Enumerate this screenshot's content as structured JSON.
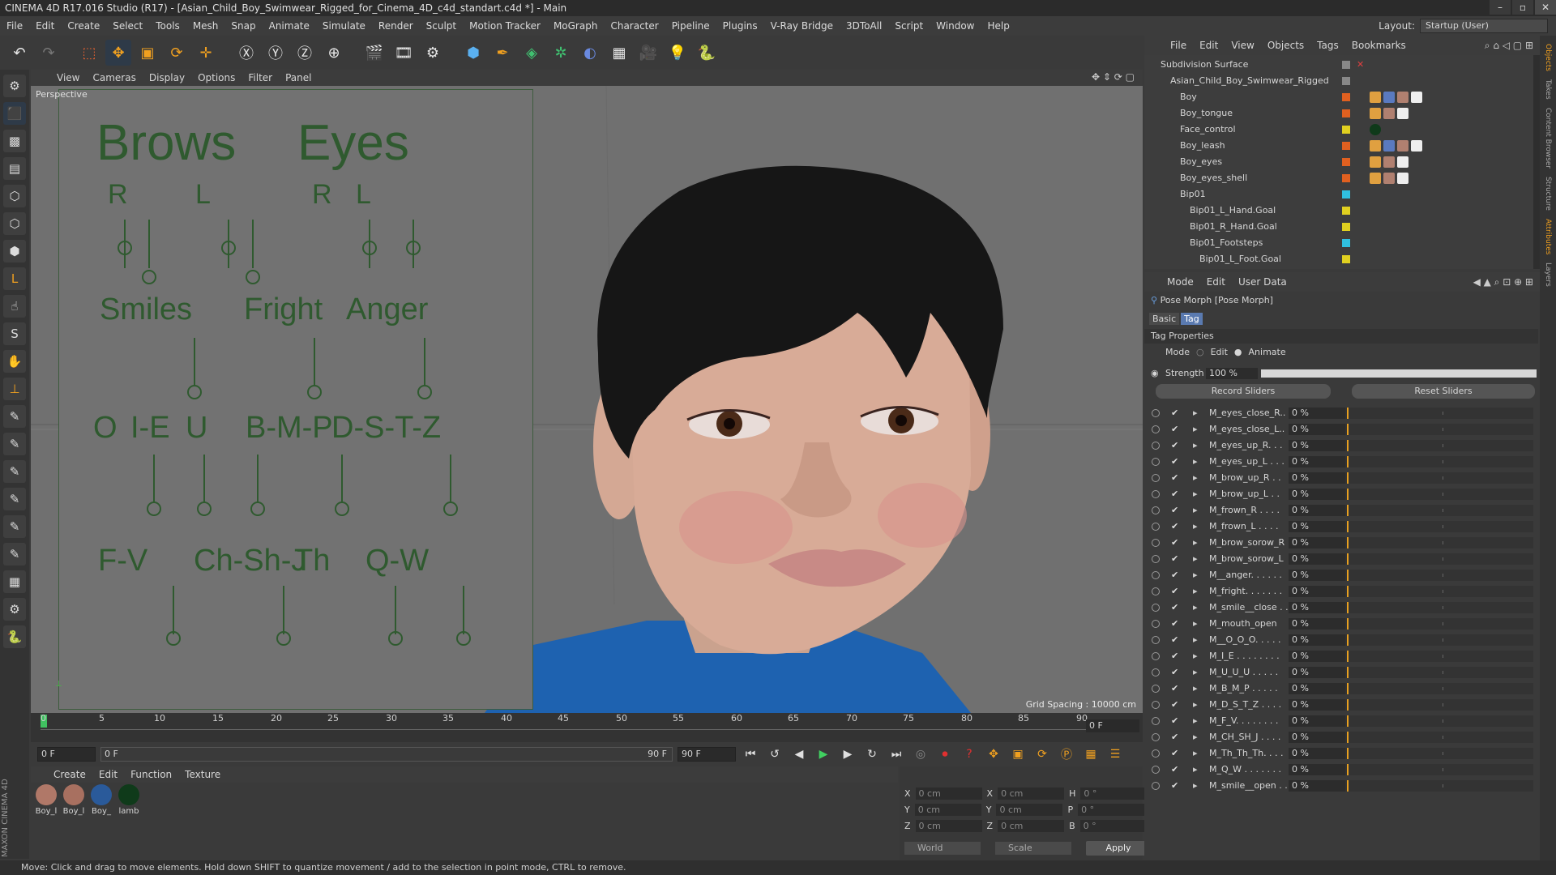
{
  "window": {
    "title": "CINEMA 4D R17.016 Studio (R17) - [Asian_Child_Boy_Swimwear_Rigged_for_Cinema_4D_c4d_standart.c4d *] - Main"
  },
  "menubar": {
    "items": [
      "File",
      "Edit",
      "Create",
      "Select",
      "Tools",
      "Mesh",
      "Snap",
      "Animate",
      "Simulate",
      "Render",
      "Sculpt",
      "Motion Tracker",
      "MoGraph",
      "Character",
      "Pipeline",
      "Plugins",
      "V-Ray Bridge",
      "3DToAll",
      "Script",
      "Window",
      "Help"
    ],
    "layout_label": "Layout:",
    "layout_value": "Startup (User)"
  },
  "viewport": {
    "menu": [
      "View",
      "Cameras",
      "Display",
      "Options",
      "Filter",
      "Panel"
    ],
    "camera": "Perspective",
    "grid_spacing": "Grid Spacing : 10000 cm"
  },
  "face_board": {
    "headers": [
      "Brows",
      "Eyes"
    ],
    "brow_lr": [
      "R",
      "L"
    ],
    "eyes_lr": [
      "R",
      "L"
    ],
    "expressions": [
      "Smiles",
      "Fright",
      "Anger"
    ],
    "phonemes_row1": [
      "O",
      "I-E",
      "U",
      "B-M-P",
      "D-S-T-Z"
    ],
    "phonemes_row2": [
      "F-V",
      "Ch-Sh-J",
      "Th",
      "Q-W"
    ]
  },
  "timeline": {
    "ticks": [
      "0",
      "5",
      "10",
      "15",
      "20",
      "25",
      "30",
      "35",
      "40",
      "45",
      "50",
      "55",
      "60",
      "65",
      "70",
      "75",
      "80",
      "85",
      "90"
    ],
    "current_frame": "0 F"
  },
  "playback": {
    "start": "0 F",
    "range_start": "0 F",
    "range_end": "90 F",
    "end": "90 F"
  },
  "material_manager": {
    "menu": [
      "Create",
      "Edit",
      "Function",
      "Texture"
    ],
    "materials": [
      {
        "name": "Boy_l",
        "color": "#b07868"
      },
      {
        "name": "Boy_l",
        "color": "#a87060"
      },
      {
        "name": "Boy_",
        "color": "#2a5a9a"
      },
      {
        "name": "lamb",
        "color": "#0f3a1a"
      }
    ]
  },
  "coordinates": {
    "rows": [
      {
        "a_label": "X",
        "a_val": "0 cm",
        "b_label": "X",
        "b_val": "0 cm",
        "c_label": "H",
        "c_val": "0 °"
      },
      {
        "a_label": "Y",
        "a_val": "0 cm",
        "b_label": "Y",
        "b_val": "0 cm",
        "c_label": "P",
        "c_val": "0 °"
      },
      {
        "a_label": "Z",
        "a_val": "0 cm",
        "b_label": "Z",
        "b_val": "0 cm",
        "c_label": "B",
        "c_val": "0 °"
      }
    ],
    "space": "World",
    "mode": "Scale",
    "apply": "Apply"
  },
  "status": "Move: Click and drag to move elements. Hold down SHIFT to quantize movement / add to the selection in point mode, CTRL to remove.",
  "object_manager": {
    "menu": [
      "File",
      "Edit",
      "View",
      "Objects",
      "Tags",
      "Bookmarks"
    ],
    "objects": [
      {
        "name": "Subdivision Surface",
        "indent": 0,
        "color": "#888888"
      },
      {
        "name": "Asian_Child_Boy_Swimwear_Rigged",
        "indent": 1,
        "color": "#888888"
      },
      {
        "name": "Boy",
        "indent": 2,
        "color": "#e06020"
      },
      {
        "name": "Boy_tongue",
        "indent": 2,
        "color": "#e06020"
      },
      {
        "name": "Face_control",
        "indent": 2,
        "color": "#e0d020"
      },
      {
        "name": "Boy_leash",
        "indent": 2,
        "color": "#e06020"
      },
      {
        "name": "Boy_eyes",
        "indent": 2,
        "color": "#e06020"
      },
      {
        "name": "Boy_eyes_shell",
        "indent": 2,
        "color": "#e06020"
      },
      {
        "name": "Bip01",
        "indent": 2,
        "color": "#30c0e0"
      },
      {
        "name": "Bip01_L_Hand.Goal",
        "indent": 3,
        "color": "#e0d020"
      },
      {
        "name": "Bip01_R_Hand.Goal",
        "indent": 3,
        "color": "#e0d020"
      },
      {
        "name": "Bip01_Footsteps",
        "indent": 3,
        "color": "#30c0e0"
      },
      {
        "name": "Bip01_L_Foot.Goal",
        "indent": 4,
        "color": "#e0d020"
      }
    ]
  },
  "attribute_manager": {
    "menu": [
      "Mode",
      "Edit",
      "User Data"
    ],
    "title": "Pose Morph [Pose Morph]",
    "tabs": [
      "Basic",
      "Tag"
    ],
    "section": "Tag Properties",
    "mode_label": "Mode",
    "mode_options": [
      "Edit",
      "Animate"
    ],
    "strength_label": "Strength",
    "strength_value": "100 %",
    "strength_fraction": 1.0,
    "record_btn": "Record Sliders",
    "reset_btn": "Reset Sliders",
    "sliders": [
      {
        "name": "M_eyes_close_R..",
        "value": "0 %"
      },
      {
        "name": "M_eyes_close_L..",
        "value": "0 %"
      },
      {
        "name": "M_eyes_up_R. . .",
        "value": "0 %"
      },
      {
        "name": "M_eyes_up_L . . .",
        "value": "0 %"
      },
      {
        "name": "M_brow_up_R . .",
        "value": "0 %"
      },
      {
        "name": "M_brow_up_L . .",
        "value": "0 %"
      },
      {
        "name": "M_frown_R . . . .",
        "value": "0 %"
      },
      {
        "name": "M_frown_L . . . .",
        "value": "0 %"
      },
      {
        "name": "M_brow_sorow_R",
        "value": "0 %"
      },
      {
        "name": "M_brow_sorow_L",
        "value": "0 %"
      },
      {
        "name": "M__anger. . . . . .",
        "value": "0 %"
      },
      {
        "name": "M_fright. . . . . . .",
        "value": "0 %"
      },
      {
        "name": "M_smile__close . .",
        "value": "0 %"
      },
      {
        "name": "M_mouth_open",
        "value": "0 %"
      },
      {
        "name": "M__O_O_O. . . . .",
        "value": "0 %"
      },
      {
        "name": "M_I_E . . . . . . . .",
        "value": "0 %"
      },
      {
        "name": "M_U_U_U . . . . .",
        "value": "0 %"
      },
      {
        "name": "M_B_M_P . . . . .",
        "value": "0 %"
      },
      {
        "name": "M_D_S_T_Z . . . .",
        "value": "0 %"
      },
      {
        "name": "M_F_V. . . . . . . .",
        "value": "0 %"
      },
      {
        "name": "M_CH_SH_J . . . .",
        "value": "0 %"
      },
      {
        "name": "M_Th_Th_Th. . . .",
        "value": "0 %"
      },
      {
        "name": "M_Q_W . . . . . . .",
        "value": "0 %"
      },
      {
        "name": "M_smile__open . .",
        "value": "0 %"
      }
    ]
  },
  "right_tabs": [
    "Objects",
    "Takes",
    "Content Browser",
    "Structure",
    "Attributes",
    "Layers"
  ]
}
